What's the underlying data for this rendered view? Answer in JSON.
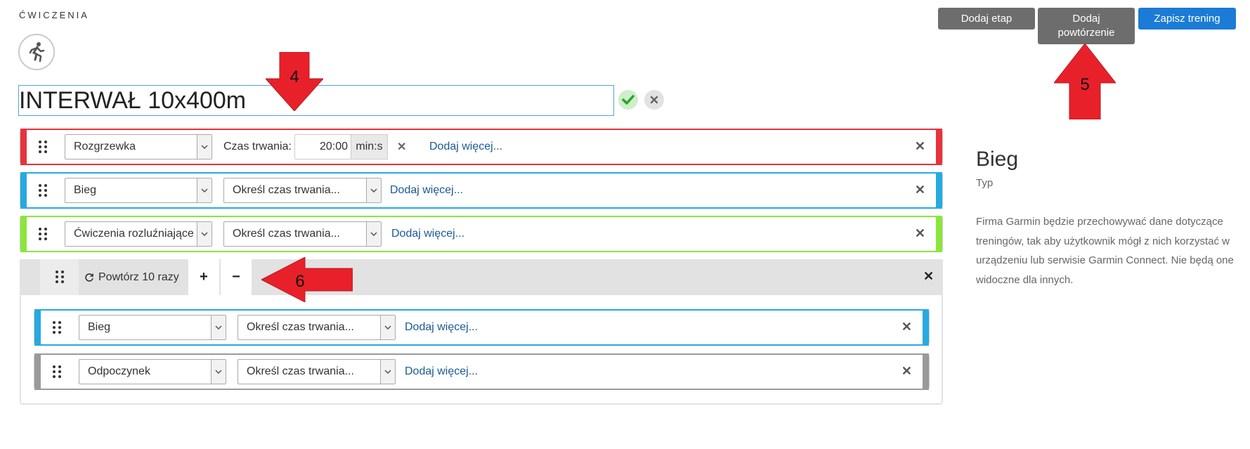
{
  "section_title": "ĆWICZENIA",
  "workout": {
    "name": "INTERWAŁ 10x400m"
  },
  "toolbar": {
    "add_step": "Dodaj etap",
    "add_repeat_line1": "Dodaj",
    "add_repeat_line2": "powtórzenie",
    "save": "Zapisz trening"
  },
  "steps": [
    {
      "type": "Rozgrzewka",
      "color": "#e8323c",
      "duration_label": "Czas trwania:",
      "duration_value": "20:00",
      "duration_unit": "min:s",
      "add_more": "Dodaj więcej..."
    },
    {
      "type": "Bieg",
      "color": "#27a9e1",
      "duration_select": "Określ czas trwania...",
      "add_more": "Dodaj więcej..."
    },
    {
      "type": "Ćwiczenia rozluźniające",
      "color": "#8be63c",
      "duration_select": "Określ czas trwania...",
      "add_more": "Dodaj więcej..."
    }
  ],
  "repeat": {
    "label": "Powtórz 10 razy",
    "plus": "+",
    "minus": "−",
    "steps": [
      {
        "type": "Bieg",
        "color": "#27a9e1",
        "duration_select": "Określ czas trwania...",
        "add_more": "Dodaj więcej..."
      },
      {
        "type": "Odpoczynek",
        "color": "#9a9a9a",
        "duration_select": "Określ czas trwania...",
        "add_more": "Dodaj więcej..."
      }
    ]
  },
  "info": {
    "title": "Bieg",
    "subtitle": "Typ",
    "description": "Firma Garmin będzie przechowywać dane dotyczące treningów, tak aby użytkownik mógł z nich korzystać w urządzeniu lub serwisie Garmin Connect. Nie będą one widoczne dla innych."
  },
  "annotations": [
    {
      "number": "4",
      "direction": "down"
    },
    {
      "number": "5",
      "direction": "up"
    },
    {
      "number": "6",
      "direction": "left"
    }
  ],
  "icons": {
    "sport": "running-person-icon",
    "confirm": "check-icon",
    "cancel": "close-icon",
    "drag": "drag-handle-icon",
    "dropdown": "chevron-down-icon",
    "repeat": "refresh-icon"
  },
  "colors": {
    "accent_blue": "#1b7bd6",
    "button_gray": "#6d6d6d",
    "annotation_red": "#e8202a"
  }
}
